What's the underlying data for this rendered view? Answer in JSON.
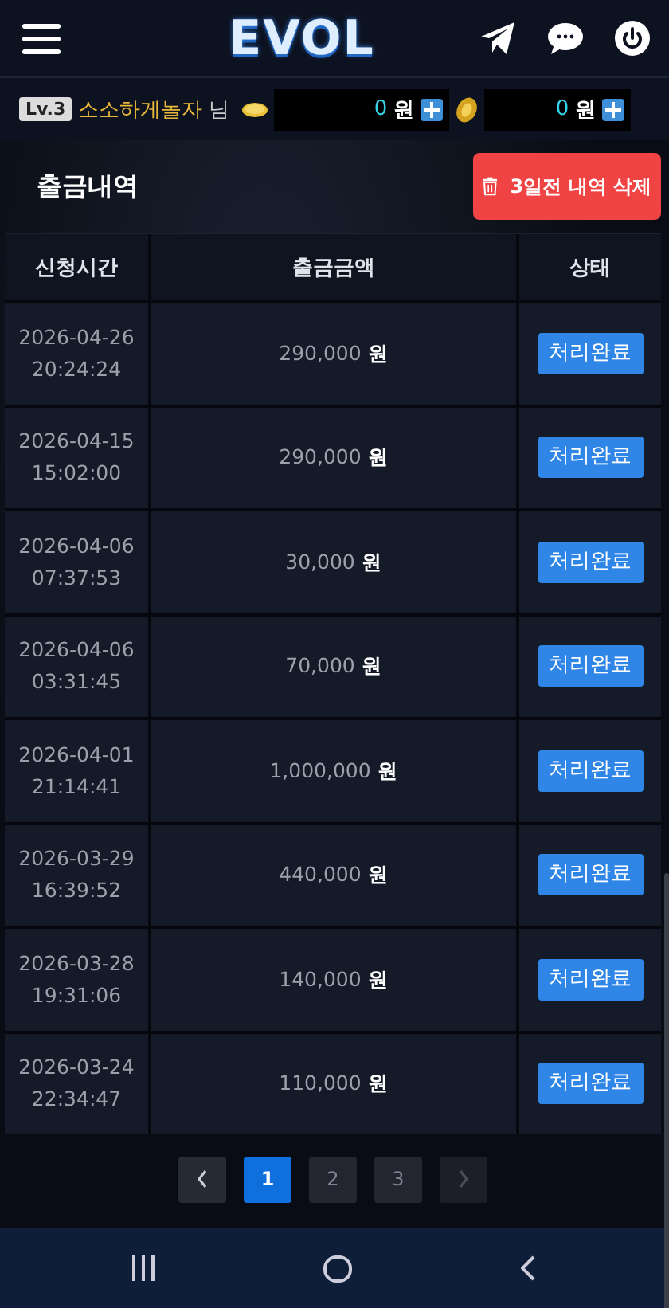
{
  "header": {
    "logo": "EVOL"
  },
  "user": {
    "level": "Lv.3",
    "name": "소소하게놀자",
    "suffix": "님",
    "balances": [
      {
        "kind": "coin",
        "amount": "0",
        "unit": "원"
      },
      {
        "kind": "chip",
        "amount": "0",
        "unit": "원"
      }
    ]
  },
  "section": {
    "title": "출금내역",
    "delete_button": "3일전 내역 삭제"
  },
  "table": {
    "columns": [
      "신청시간",
      "출금금액",
      "상태"
    ],
    "rows": [
      {
        "date": "2026-04-26",
        "time": "20:24:24",
        "amount": "290,000",
        "unit": "원",
        "status": "처리완료"
      },
      {
        "date": "2026-04-15",
        "time": "15:02:00",
        "amount": "290,000",
        "unit": "원",
        "status": "처리완료"
      },
      {
        "date": "2026-04-06",
        "time": "07:37:53",
        "amount": "30,000",
        "unit": "원",
        "status": "처리완료"
      },
      {
        "date": "2026-04-06",
        "time": "03:31:45",
        "amount": "70,000",
        "unit": "원",
        "status": "처리완료"
      },
      {
        "date": "2026-04-01",
        "time": "21:14:41",
        "amount": "1,000,000",
        "unit": "원",
        "status": "처리완료"
      },
      {
        "date": "2026-03-29",
        "time": "16:39:52",
        "amount": "440,000",
        "unit": "원",
        "status": "처리완료"
      },
      {
        "date": "2026-03-28",
        "time": "19:31:06",
        "amount": "140,000",
        "unit": "원",
        "status": "처리완료"
      },
      {
        "date": "2026-03-24",
        "time": "22:34:47",
        "amount": "110,000",
        "unit": "원",
        "status": "처리완료"
      }
    ]
  },
  "pagination": {
    "prev": {
      "disabled": false
    },
    "next": {
      "disabled": true
    },
    "pages": [
      {
        "label": "1",
        "selected": true
      },
      {
        "label": "2",
        "selected": false
      },
      {
        "label": "3",
        "selected": false
      }
    ]
  }
}
